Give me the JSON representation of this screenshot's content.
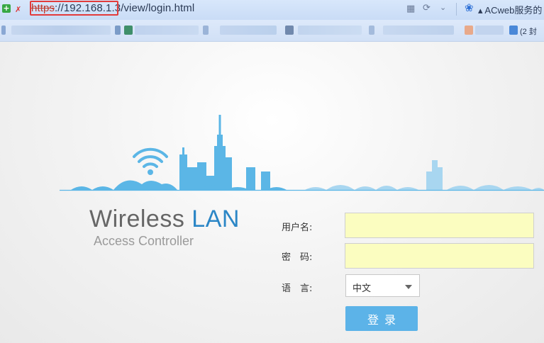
{
  "browser": {
    "url_scheme": "https",
    "url_host": "://192.168.1.3",
    "url_path": "/view/login.html",
    "search_engine_text": "ACweb服务的",
    "mail_text": "(2 封"
  },
  "brand": {
    "title_part1": "Wireless ",
    "title_part2": "LAN",
    "subtitle": "Access Controller",
    "accent_color": "#2b86c6"
  },
  "form": {
    "username_label": "用户名:",
    "username_value": "",
    "password_label": "密　码:",
    "password_value": "",
    "language_label": "语　言:",
    "language_selected": "中文",
    "login_button": "登录"
  },
  "icons": {
    "new_tab": "plus-icon",
    "certificate": "cert-error-icon",
    "qr": "qr-icon",
    "reload": "reload-icon",
    "search_engine": "paw-icon"
  }
}
